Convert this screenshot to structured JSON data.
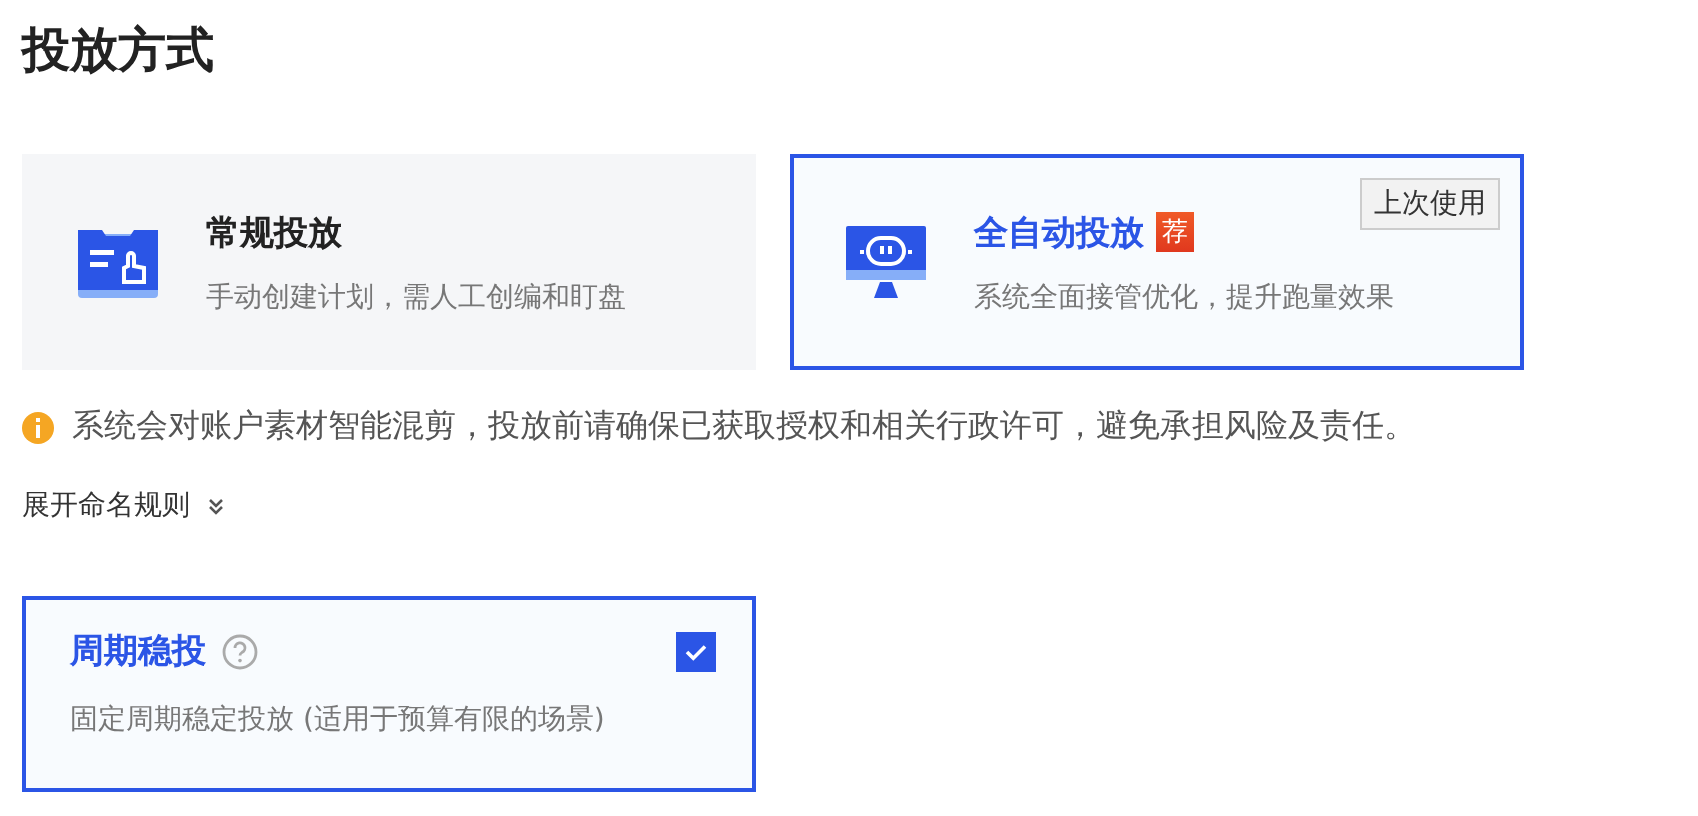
{
  "title": "投放方式",
  "modes": [
    {
      "kind": "manual",
      "name": "常规投放",
      "desc": "手动创建计划，需人工创编和盯盘",
      "selected": false
    },
    {
      "kind": "auto",
      "name": "全自动投放",
      "badge": "荐",
      "tag": "上次使用",
      "desc": "系统全面接管优化，提升跑量效果",
      "selected": true
    }
  ],
  "notice": "系统会对账户素材智能混剪，投放前请确保已获取授权和相关行政许可，避免承担风险及责任。",
  "expand_link": "展开命名规则",
  "option": {
    "name": "周期稳投",
    "desc": "固定周期稳定投放 (适用于预算有限的场景)",
    "checked": true,
    "selected": true
  }
}
